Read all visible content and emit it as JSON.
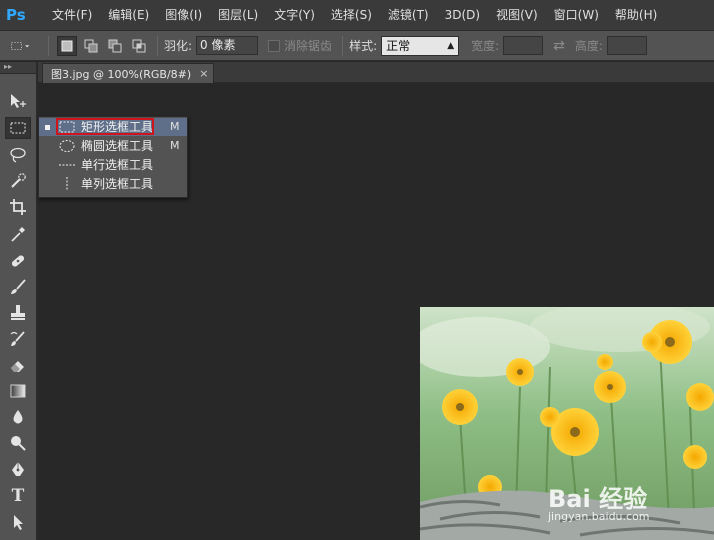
{
  "app": {
    "logo": "Ps"
  },
  "menu": [
    "文件(F)",
    "编辑(E)",
    "图像(I)",
    "图层(L)",
    "文字(Y)",
    "选择(S)",
    "滤镜(T)",
    "3D(D)",
    "视图(V)",
    "窗口(W)",
    "帮助(H)"
  ],
  "options": {
    "feather_label": "羽化:",
    "feather_value": "0 像素",
    "antialias_label": "消除锯齿",
    "style_label": "样式:",
    "style_value": "正常",
    "width_label": "宽度:",
    "height_label": "高度:"
  },
  "document": {
    "tab_title": "图3.jpg @ 100%(RGB/8#)",
    "close_glyph": "×"
  },
  "flyout": [
    {
      "label": "矩形选框工具",
      "key": "M",
      "icon": "rect-marquee-icon",
      "selected": true
    },
    {
      "label": "椭圆选框工具",
      "key": "M",
      "icon": "ellipse-marquee-icon",
      "selected": false
    },
    {
      "label": "单行选框工具",
      "key": "",
      "icon": "single-row-marquee-icon",
      "selected": false
    },
    {
      "label": "单列选框工具",
      "key": "",
      "icon": "single-column-marquee-icon",
      "selected": false
    }
  ],
  "tools": [
    "move-icon",
    "rect-marquee-icon",
    "lasso-icon",
    "quick-select-icon",
    "crop-icon",
    "eyedropper-icon",
    "healing-brush-icon",
    "brush-icon",
    "clone-stamp-icon",
    "history-brush-icon",
    "eraser-icon",
    "gradient-icon",
    "blur-icon",
    "dodge-icon",
    "pen-icon",
    "type-icon",
    "path-select-icon"
  ],
  "type_tool_glyph": "T",
  "watermark": {
    "brand": "Bai 经验",
    "url": "jingyan.baidu.com"
  },
  "colors": {
    "accent": "#31a8ff",
    "highlight_box": "#d0141c",
    "menu_highlight": "#5f6f8a"
  }
}
